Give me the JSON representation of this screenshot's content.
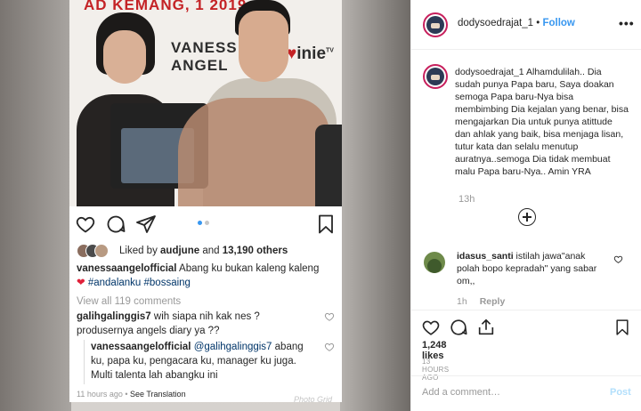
{
  "embedded": {
    "banner": {
      "title": "AD KEMANG, 1 2019",
      "name_line1": "VANESS",
      "name_line2": "ANGEL",
      "logo": "inie",
      "logo_suffix": "TV"
    },
    "liked": {
      "prefix": "Liked by ",
      "user": "audjune",
      "middle": " and ",
      "count": "13,190 others"
    },
    "caption": {
      "user": "vanessaangelofficial",
      "text": " Abang ku bukan kaleng kaleng",
      "heart": "❤",
      "tags": " #andalanku #bossaing"
    },
    "view_all": "View all 119 comments",
    "comments": [
      {
        "user": "galihgalinggis7",
        "text": " wih siapa nih kak nes ? produsernya angels diary ya ??"
      },
      {
        "user": "vanessaangelofficial",
        "mention": " @galihgalinggis7",
        "text": " abang ku, papa ku, pengacara ku, manager ku juga. Multi talenta lah abangku ini"
      }
    ],
    "footer": {
      "time": "11 hours ago",
      "sep": " • ",
      "link": "See Translation"
    },
    "watermark": "Photo Grid"
  },
  "post": {
    "header": {
      "username": "dodysoedrajat_1",
      "separator": " • ",
      "follow": "Follow",
      "more": "•••"
    },
    "caption": {
      "user": "dodysoedrajat_1",
      "text": " Alhamdulilah.. Dia sudah punya Papa baru, Saya doakan semoga Papa baru-Nya bisa membimbing Dia kejalan yang benar, bisa mengajarkan Dia untuk punya atittude dan ahlak yang baik, bisa menjaga lisan, tutur kata dan selalu menutup auratnya..semoga Dia tidak membuat malu Papa baru-Nya.. Amin YRA"
    },
    "caption_time": "13h",
    "comment": {
      "user": "idasus_santi",
      "text": " istilah jawa\"anak polah bopo kepradah\" yang sabar om,,",
      "time": "1h",
      "reply": "Reply"
    },
    "likes": "1,248 likes",
    "date": "13 HOURS AGO",
    "add_comment_placeholder": "Add a comment…",
    "post_button": "Post"
  },
  "colors": {
    "follow": "#3897f0",
    "heart": "#e0213a",
    "link_tag": "#003569",
    "story_ring": "#c71f5c",
    "muted": "#999999",
    "post_disabled": "#b2dffc"
  },
  "icons": {
    "embedded": [
      "heart-icon",
      "comment-icon",
      "share-icon",
      "bookmark-icon"
    ],
    "panel": [
      "heart-icon",
      "comment-icon",
      "share-icon",
      "bookmark-icon",
      "add-circle-icon"
    ]
  }
}
